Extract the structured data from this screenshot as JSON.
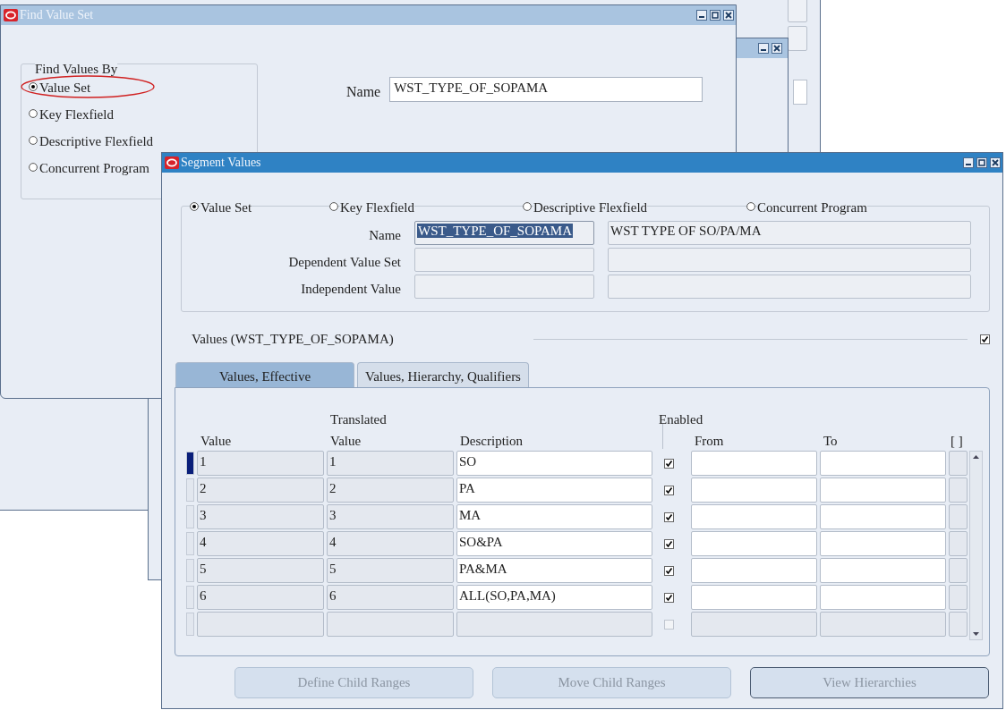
{
  "find_window": {
    "title": "Find Value Set",
    "group_label": "Find Values By",
    "options": [
      {
        "label": "Value Set",
        "selected": true,
        "annotated": true
      },
      {
        "label": "Key Flexfield",
        "selected": false,
        "annotated": false
      },
      {
        "label": "Descriptive Flexfield",
        "selected": false,
        "annotated": false
      },
      {
        "label": "Concurrent Program",
        "selected": false,
        "annotated": false
      }
    ],
    "name_label": "Name",
    "name_value": "WST_TYPE_OF_SOPAMA"
  },
  "segment_window": {
    "title": "Segment Values",
    "options": [
      {
        "label": "Value Set",
        "selected": true
      },
      {
        "label": "Key Flexfield",
        "selected": false
      },
      {
        "label": "Descriptive Flexfield",
        "selected": false
      },
      {
        "label": "Concurrent Program",
        "selected": false
      }
    ],
    "fields": [
      {
        "label": "Name",
        "value": "WST_TYPE_OF_SOPAMA",
        "highlighted": true,
        "description": "WST TYPE OF SO/PA/MA"
      },
      {
        "label": "Dependent Value Set",
        "highlighted": false
      },
      {
        "label": "Independent Value",
        "highlighted": false
      }
    ],
    "values_title": "Values (WST_TYPE_OF_SOPAMA)",
    "values_checked": true,
    "tabs": [
      {
        "label": "Values, Effective",
        "selected": true
      },
      {
        "label": "Values, Hierarchy, Qualifiers",
        "selected": false
      }
    ],
    "columns": [
      {
        "label": "Value"
      },
      {
        "top": "Translated",
        "label": "Value"
      },
      {
        "label": "Description"
      },
      {
        "top": "Enabled"
      },
      {
        "label": "From"
      },
      {
        "label": "To"
      },
      {
        "label": "[ ]"
      }
    ],
    "rows": [
      {
        "value": "1",
        "translated": "1",
        "description": "SO",
        "enabled": true,
        "disabled": false,
        "current": true
      },
      {
        "value": "2",
        "translated": "2",
        "description": "PA",
        "enabled": true,
        "disabled": false,
        "current": false
      },
      {
        "value": "3",
        "translated": "3",
        "description": "MA",
        "enabled": true,
        "disabled": false,
        "current": false
      },
      {
        "value": "4",
        "translated": "4",
        "description": "SO&PA",
        "enabled": true,
        "disabled": false,
        "current": false
      },
      {
        "value": "5",
        "translated": "5",
        "description": "PA&MA",
        "enabled": true,
        "disabled": false,
        "current": false
      },
      {
        "value": "6",
        "translated": "6",
        "description": "ALL(SO,PA,MA)",
        "enabled": true,
        "disabled": false,
        "current": false
      },
      {
        "enabled": false,
        "disabled": true,
        "current": false
      }
    ],
    "buttons": [
      {
        "label": "Define Child Ranges",
        "focused": false
      },
      {
        "label": "Move Child Ranges",
        "focused": false
      },
      {
        "label": "View Hierarchies",
        "focused": true
      }
    ]
  }
}
